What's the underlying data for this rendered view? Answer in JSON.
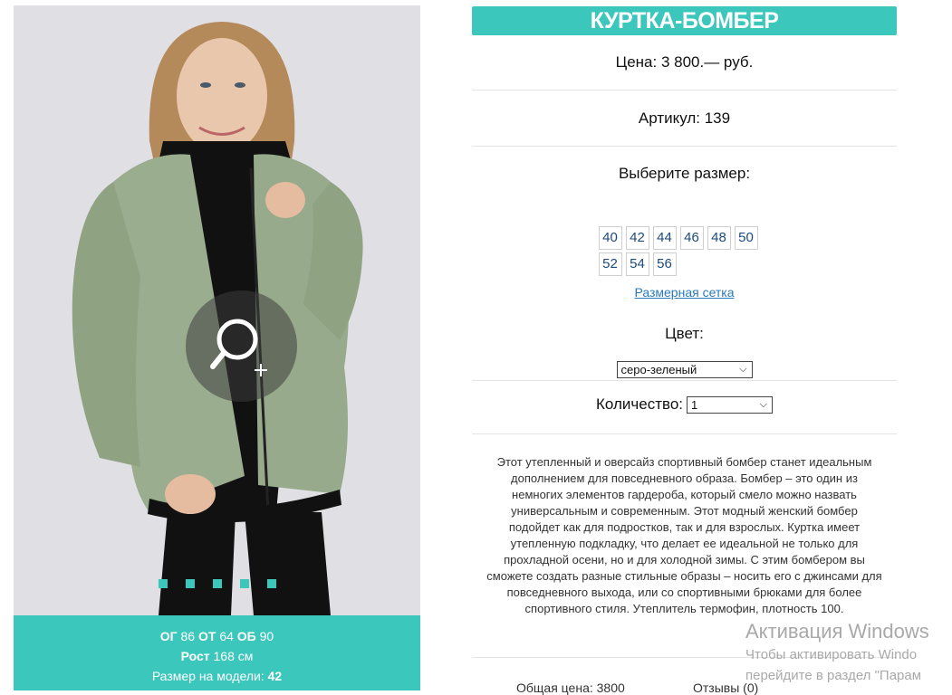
{
  "product": {
    "title": "КУРТКА-БОМБЕР",
    "price": "Цена: 3 800.— руб.",
    "sku": "Артикул: 139",
    "size_label": "Выберите размер:",
    "sizes": [
      "40",
      "42",
      "44",
      "46",
      "48",
      "50",
      "52",
      "54",
      "56"
    ],
    "size_chart_link": "Размерная сетка",
    "color_label": "Цвет:",
    "color_value": "серо-зеленый",
    "quantity_label": "Количество:",
    "quantity_value": "1",
    "description": "Этот утепленный и оверсайз спортивный бомбер станет идеальным дополнением для повседневного образа. Бомбер – это один из немногих элементов гардероба, который смело можно назвать универсальным и современным. Этот модный женский бомбер подойдет как для подростков, так и для взрослых. Куртка имеет утепленную подкладку, что делает ее идеальной не только для прохладной осени, но и для холодной зимы. С этим бомбером вы сможете создать разные стильные образы – носить его с джинсами для повседневного выхода, или со спортивными брюками для более спортивного стиля. Утеплитель термофин, плотность 100.",
    "total": "Общая цена: 3800",
    "reviews": "Отзывы (0)"
  },
  "model": {
    "og_label": "ОГ",
    "og_value": "86",
    "ot_label": "ОТ",
    "ot_value": "64",
    "ob_label": "ОБ",
    "ob_value": "90",
    "height_label": "Рост",
    "height_value": "168 см",
    "size_label": "Размер на модели:",
    "size_value": "42"
  },
  "gallery": {
    "slides": 5,
    "zoom_icon": "zoom-in-icon"
  },
  "watermark": {
    "title": "Активация Windows",
    "line1": "Чтобы активировать Windo",
    "line2": "перейдите в раздел \"Парам"
  },
  "colors": {
    "accent": "#3cc7bd",
    "link": "#2a7ab8",
    "size_text": "#1d4a7a"
  }
}
